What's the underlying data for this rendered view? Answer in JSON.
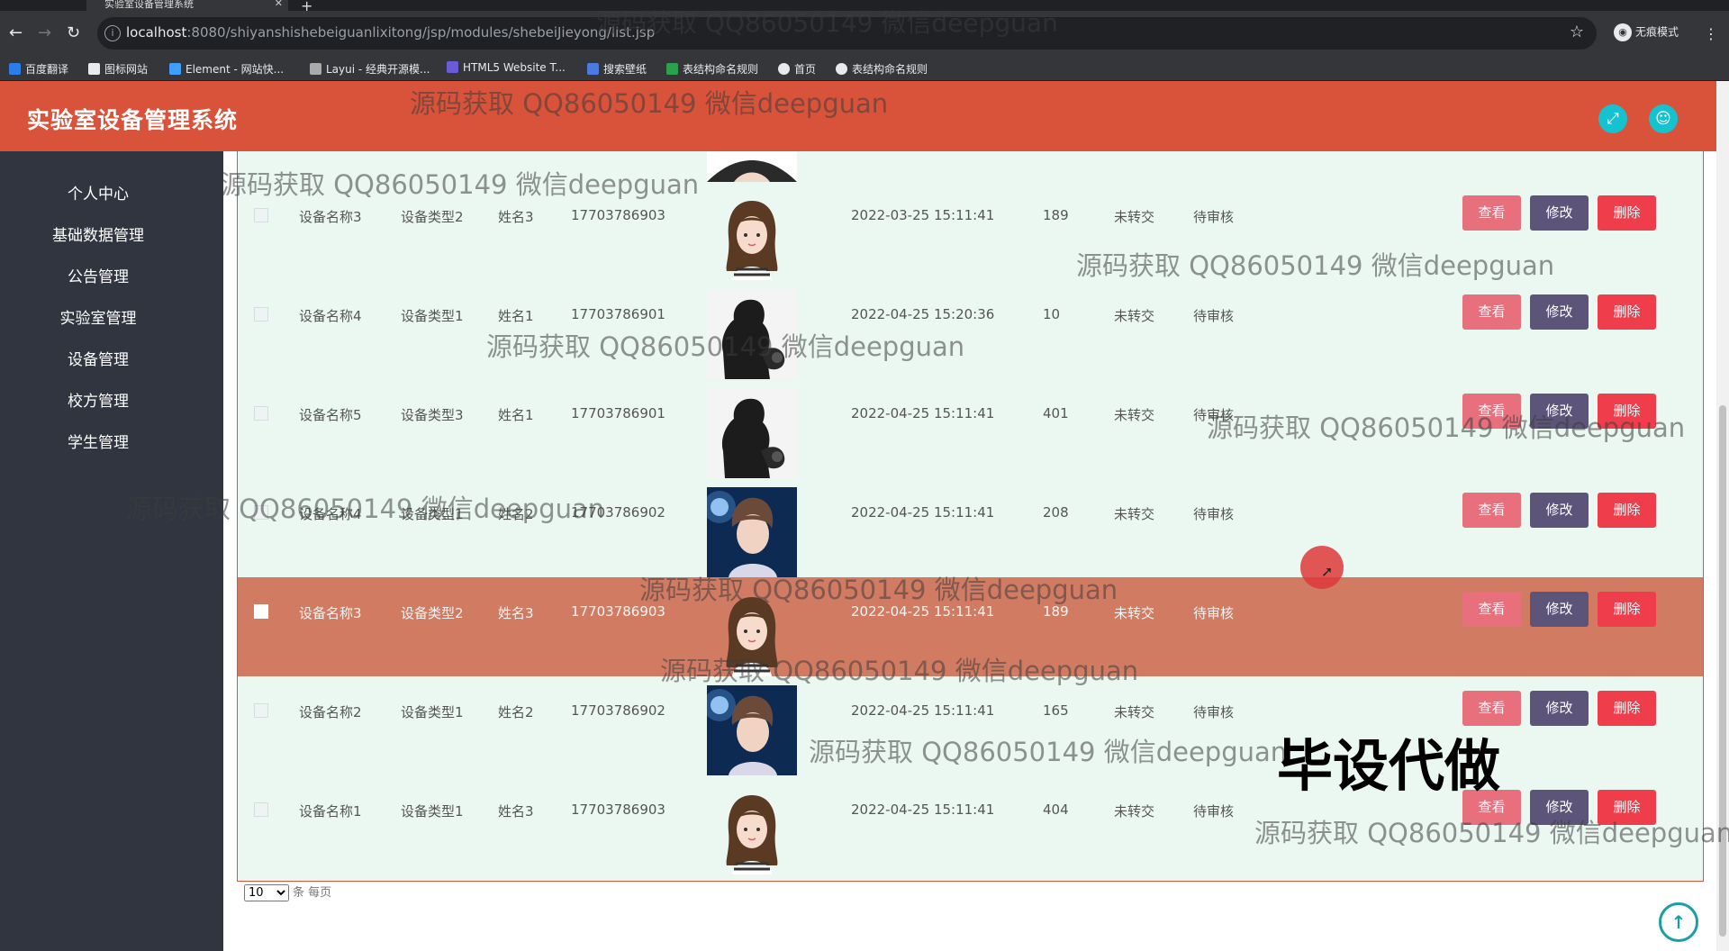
{
  "browser": {
    "tab_title": "实验室设备管理系统",
    "url_host": "localhost",
    "url_path": ":8080/shiyanshishebeiguanlixitong/jsp/modules/shebeiJieyong/list.jsp",
    "incognito_label": "无痕模式",
    "bookmarks": [
      "百度翻译",
      "图标网站",
      "Element - 网站快...",
      "Layui - 经典开源模...",
      "HTML5 Website T...",
      "搜索壁纸",
      "表结构命名规则",
      "首页",
      "表结构命名规则"
    ]
  },
  "app": {
    "title": "实验室设备管理系统"
  },
  "sidebar": {
    "items": [
      "个人中心",
      "基础数据管理",
      "公告管理",
      "实验室管理",
      "设备管理",
      "校方管理",
      "学生管理"
    ]
  },
  "table": {
    "rows": [
      {
        "name": "设备名称3",
        "type": "设备类型2",
        "user": "姓名3",
        "phone": "17703786903",
        "avatar": "girl",
        "time": "2022-03-25 15:11:41",
        "count": "189",
        "transfer": "未转交",
        "status": "待审核"
      },
      {
        "name": "设备名称4",
        "type": "设备类型1",
        "user": "姓名1",
        "phone": "17703786901",
        "avatar": "man",
        "time": "2022-04-25 15:20:36",
        "count": "10",
        "transfer": "未转交",
        "status": "待审核"
      },
      {
        "name": "设备名称5",
        "type": "设备类型3",
        "user": "姓名1",
        "phone": "17703786901",
        "avatar": "man",
        "time": "2022-04-25 15:11:41",
        "count": "401",
        "transfer": "未转交",
        "status": "待审核"
      },
      {
        "name": "设备名称4",
        "type": "设备类型1",
        "user": "姓名2",
        "phone": "17703786902",
        "avatar": "boy",
        "time": "2022-04-25 15:11:41",
        "count": "208",
        "transfer": "未转交",
        "status": "待审核"
      },
      {
        "name": "设备名称3",
        "type": "设备类型2",
        "user": "姓名3",
        "phone": "17703786903",
        "avatar": "girl",
        "time": "2022-04-25 15:11:41",
        "count": "189",
        "transfer": "未转交",
        "status": "待审核"
      },
      {
        "name": "设备名称2",
        "type": "设备类型1",
        "user": "姓名2",
        "phone": "17703786902",
        "avatar": "boy",
        "time": "2022-04-25 15:11:41",
        "count": "165",
        "transfer": "未转交",
        "status": "待审核"
      },
      {
        "name": "设备名称1",
        "type": "设备类型1",
        "user": "姓名3",
        "phone": "17703786903",
        "avatar": "girl",
        "time": "2022-04-25 15:11:41",
        "count": "404",
        "transfer": "未转交",
        "status": "待审核"
      }
    ],
    "actions": {
      "view": "查看",
      "edit": "修改",
      "delete": "删除"
    }
  },
  "pagination": {
    "page_size": "10",
    "page_size_suffix": "条 每页"
  },
  "watermark": {
    "text": "源码获取 QQ86050149 微信deepguan",
    "big_text": "毕设代做"
  },
  "colors": {
    "header": "#d9523a",
    "sidebar": "#303540",
    "table_bg": "#eaf8f1",
    "highlight_row": "#d27b63",
    "view_button": "#e86f7c",
    "edit_button": "#5d5479",
    "delete_button": "#f03d4c",
    "header_icon": "#14c3cf"
  }
}
